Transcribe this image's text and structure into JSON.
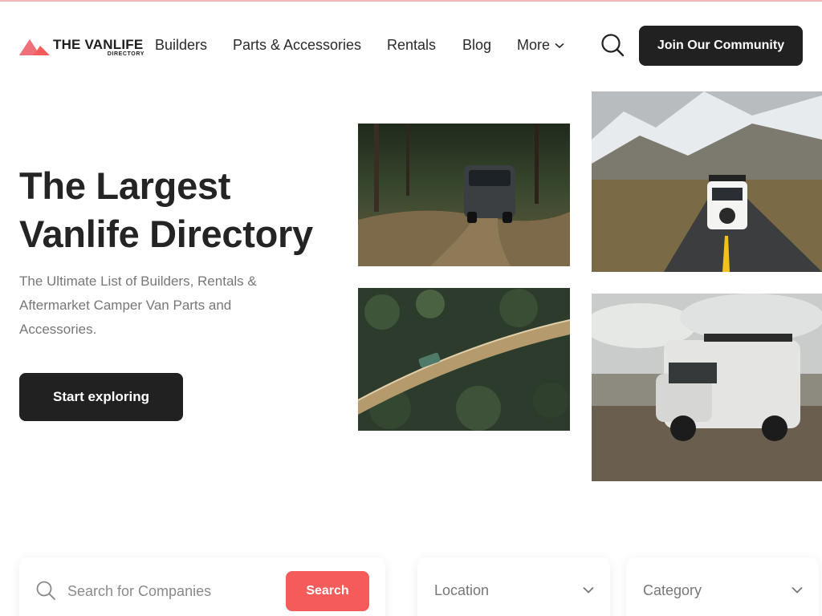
{
  "brand": {
    "name": "THE VANLIFE",
    "tagline": "DIRECTORY",
    "accent": "#f45b5b"
  },
  "nav": {
    "items": [
      {
        "label": "Builders"
      },
      {
        "label": "Parts & Accessories"
      },
      {
        "label": "Rentals"
      },
      {
        "label": "Blog"
      },
      {
        "label": "More"
      }
    ],
    "search_icon": "search-icon",
    "cta_label": "Join Our Community"
  },
  "hero": {
    "title_line1": "The Largest",
    "title_line2": "Vanlife Directory",
    "subtitle": "The Ultimate List of Builders, Rentals & Aftermarket Camper Van Parts and Accessories.",
    "cta_label": "Start exploring"
  },
  "gallery": [
    {
      "subject": "van on a forest dirt track"
    },
    {
      "subject": "van on a mountain road"
    },
    {
      "subject": "van crossing a bridge over a forest"
    },
    {
      "subject": "van parked on a gravel plain"
    }
  ],
  "filters": {
    "search_placeholder": "Search for Companies",
    "search_button": "Search",
    "location_label": "Location",
    "category_label": "Category"
  },
  "colors": {
    "dark_button": "#212121",
    "accent": "#f45b5b",
    "muted_text": "#777777"
  }
}
